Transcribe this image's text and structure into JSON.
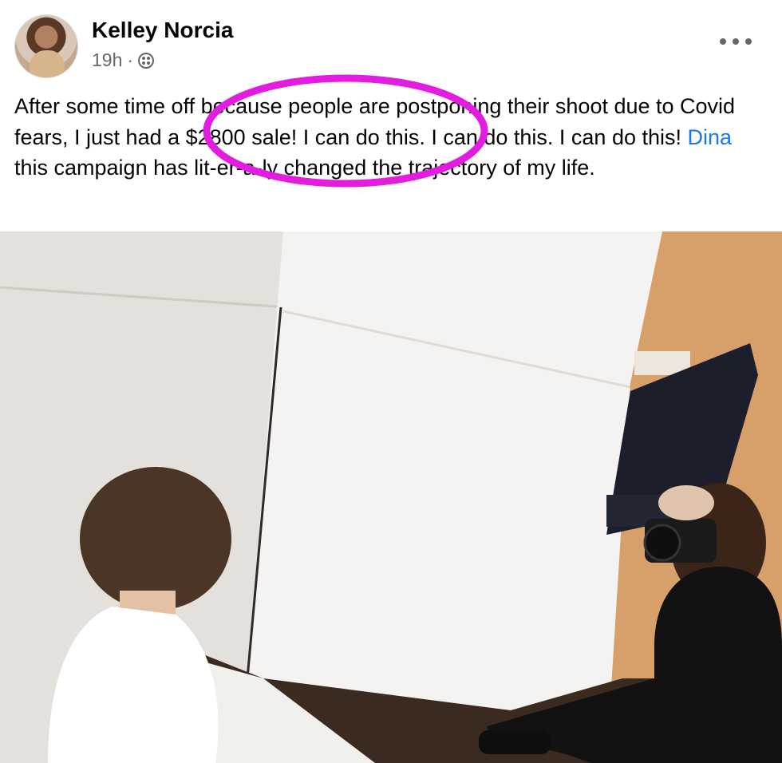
{
  "post": {
    "author": "Kelley Norcia",
    "time": "19h",
    "separator": "·",
    "audience_icon": "friends-globe-icon",
    "more_icon": "more-options-icon",
    "text_before_mention": "After some time off because people are postponing their shoot due to Covid fears, I just had a $2800 sale! I can do this. I can do this. I can do this! ",
    "mention": "Dina",
    "text_after_mention": " this campaign has lit-er-a-ly changed the trajectory of my life."
  },
  "annotation": {
    "color": "#e21de0"
  },
  "colors": {
    "link": "#1877f2",
    "meta": "#65676b",
    "text": "#050505"
  }
}
